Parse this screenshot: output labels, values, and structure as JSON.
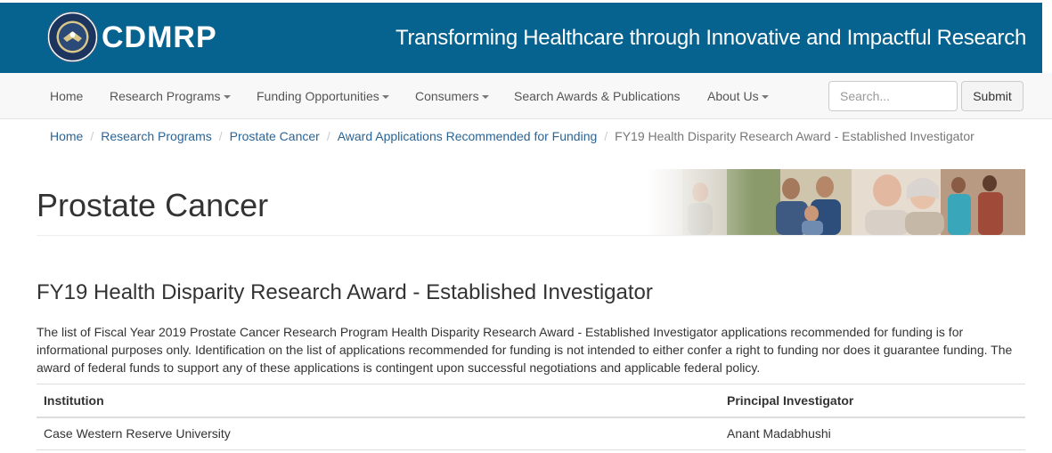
{
  "header": {
    "brand": "CDMRP",
    "tagline": "Transforming Healthcare through Innovative and Impactful Research",
    "seal_icon": "dod-seal-icon"
  },
  "nav": {
    "items": [
      {
        "label": "Home",
        "dropdown": false
      },
      {
        "label": "Research Programs",
        "dropdown": true
      },
      {
        "label": "Funding Opportunities",
        "dropdown": true
      },
      {
        "label": "Consumers",
        "dropdown": true
      },
      {
        "label": "Search Awards & Publications",
        "dropdown": false
      },
      {
        "label": "About Us",
        "dropdown": true
      }
    ],
    "search_placeholder": "Search...",
    "submit_label": "Submit"
  },
  "breadcrumb": {
    "items": [
      "Home",
      "Research Programs",
      "Prostate Cancer",
      "Award Applications Recommended for Funding"
    ],
    "current": "FY19 Health Disparity Research Award - Established Investigator"
  },
  "page": {
    "title": "Prostate Cancer",
    "section_title": "FY19 Health Disparity Research Award - Established Investigator",
    "description": "The list of Fiscal Year 2019 Prostate Cancer Research Program Health Disparity Research Award - Established Investigator applications recommended for funding is for informational purposes only. Identification on the list of applications recommended for funding is not intended to either confer a right to funding nor does it guarantee funding. The award of federal funds to support any of these applications is contingent upon successful negotiations and applicable federal policy."
  },
  "table": {
    "headers": [
      "Institution",
      "Principal Investigator"
    ],
    "rows": [
      [
        "Case Western Reserve University",
        "Anant Madabhushi"
      ]
    ]
  },
  "colors": {
    "header_bg": "#06628f",
    "link": "#2a6496",
    "nav_bg": "#f8f8f8"
  }
}
